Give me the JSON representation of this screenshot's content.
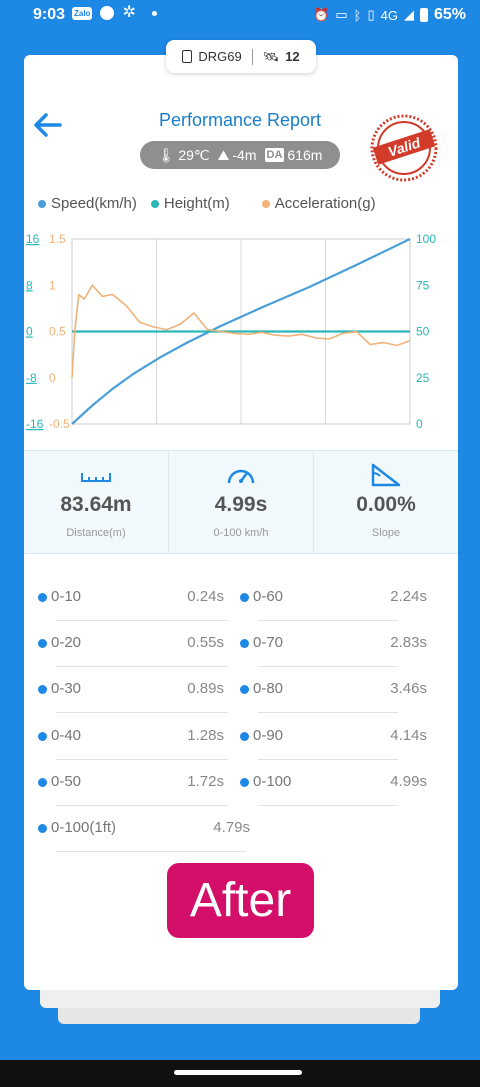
{
  "status_bar": {
    "time": "9:03",
    "zalo": "Zalo",
    "network": "4G",
    "battery": "65%"
  },
  "device": {
    "name": "DRG69",
    "satellites": "12"
  },
  "header": {
    "title": "Performance Report",
    "stamp": "Valid"
  },
  "conditions": {
    "temperature": "29℃",
    "altitude": "-4m",
    "da_label": "DA",
    "density_altitude": "616m"
  },
  "legend": [
    {
      "label": "Speed(km/h)",
      "color": "#4a9fd8"
    },
    {
      "label": "Height(m)",
      "color": "#2ab7b7"
    },
    {
      "label": "Acceleration(g)",
      "color": "#f0b27a"
    }
  ],
  "chart_data": {
    "type": "line",
    "grid": true,
    "axes": {
      "height_ticks": [
        "16",
        "8",
        "0",
        "-8",
        "-16"
      ],
      "accel_ticks": [
        "1.5",
        "1",
        "0.5",
        "0",
        "-0.5"
      ],
      "speed_ticks": [
        "100",
        "75",
        "50",
        "25",
        "0"
      ],
      "height_range": [
        -16,
        16
      ],
      "accel_range": [
        -0.5,
        1.5
      ],
      "speed_range": [
        0,
        100
      ]
    },
    "series": [
      {
        "name": "Speed(km/h)",
        "color": "#4a9fd8",
        "axis": "speed",
        "x": [
          0,
          0.3,
          0.6,
          0.9,
          1.3,
          1.7,
          2.2,
          2.8,
          3.5,
          4.2,
          4.99
        ],
        "values": [
          0,
          10,
          19,
          27,
          36,
          44,
          53,
          63,
          74,
          86,
          100
        ]
      },
      {
        "name": "Height(m)",
        "color": "#2ab7b7",
        "axis": "height",
        "x": [
          0,
          4.99
        ],
        "values": [
          0,
          0
        ]
      },
      {
        "name": "Acceleration(g)",
        "color": "#f0b27a",
        "axis": "accel",
        "x": [
          0,
          0.04,
          0.1,
          0.18,
          0.3,
          0.45,
          0.6,
          0.8,
          1.0,
          1.2,
          1.4,
          1.6,
          1.8,
          2.0,
          2.2,
          2.4,
          2.6,
          2.8,
          3.0,
          3.2,
          3.4,
          3.6,
          3.8,
          4.0,
          4.2,
          4.4,
          4.6,
          4.8,
          4.99
        ],
        "values": [
          0,
          0.5,
          0.9,
          0.85,
          1.0,
          0.88,
          0.9,
          0.78,
          0.6,
          0.55,
          0.52,
          0.58,
          0.7,
          0.52,
          0.5,
          0.48,
          0.47,
          0.49,
          0.46,
          0.45,
          0.47,
          0.43,
          0.42,
          0.48,
          0.5,
          0.36,
          0.38,
          0.35,
          0.4
        ]
      }
    ]
  },
  "metrics": [
    {
      "value": "83.64m",
      "label": "Distance(m)"
    },
    {
      "value": "4.99s",
      "label": "0-100 km/h"
    },
    {
      "value": "0.00%",
      "label": "Slope"
    }
  ],
  "splits": [
    {
      "label": "0-10",
      "time": "0.24s"
    },
    {
      "label": "0-60",
      "time": "2.24s"
    },
    {
      "label": "0-20",
      "time": "0.55s"
    },
    {
      "label": "0-70",
      "time": "2.83s"
    },
    {
      "label": "0-30",
      "time": "0.89s"
    },
    {
      "label": "0-80",
      "time": "3.46s"
    },
    {
      "label": "0-40",
      "time": "1.28s"
    },
    {
      "label": "0-90",
      "time": "4.14s"
    },
    {
      "label": "0-50",
      "time": "1.72s"
    },
    {
      "label": "0-100",
      "time": "4.99s"
    },
    {
      "label": "0-100(1ft)",
      "time": "4.79s"
    }
  ],
  "badge": "After"
}
